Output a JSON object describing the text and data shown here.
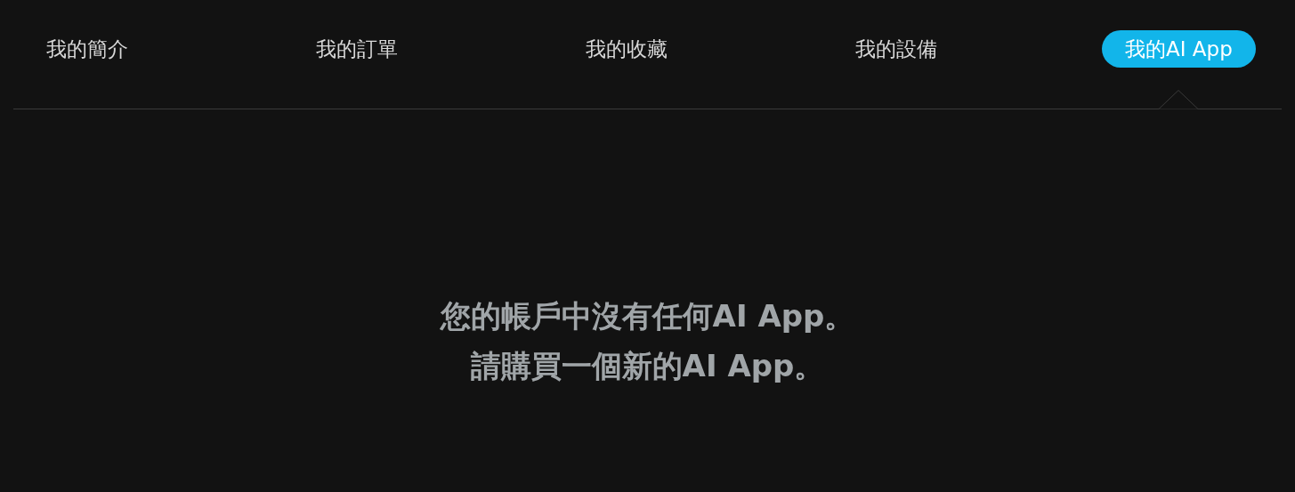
{
  "tabs": [
    {
      "label": "我的簡介",
      "selected": false
    },
    {
      "label": "我的訂單",
      "selected": false
    },
    {
      "label": "我的收藏",
      "selected": false
    },
    {
      "label": "我的設備",
      "selected": false
    },
    {
      "label": "我的AI App",
      "selected": true
    }
  ],
  "message": [
    "您的帳戶中沒有任何AI App。",
    "請購買一個新的AI App。"
  ]
}
